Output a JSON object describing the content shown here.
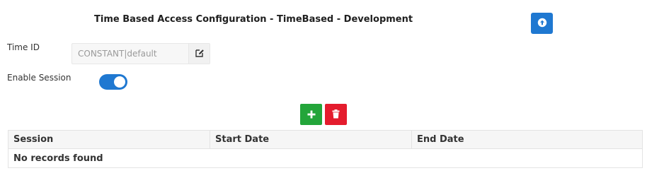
{
  "header": {
    "title": "Time Based Access Configuration - TimeBased - Development"
  },
  "form": {
    "time_id_label": "Time ID",
    "time_id_value": "CONSTANT|default",
    "enable_session_label": "Enable Session",
    "enable_session_on": true
  },
  "table": {
    "columns": [
      "Session",
      "Start Date",
      "End Date"
    ],
    "empty_message": "No records found"
  },
  "colors": {
    "primary": "#1f78d1",
    "add": "#23a53a",
    "delete": "#e41c2d"
  },
  "icons": {
    "upload": "upload-icon",
    "edit": "edit-icon",
    "add": "plus-icon",
    "delete": "trash-icon"
  }
}
